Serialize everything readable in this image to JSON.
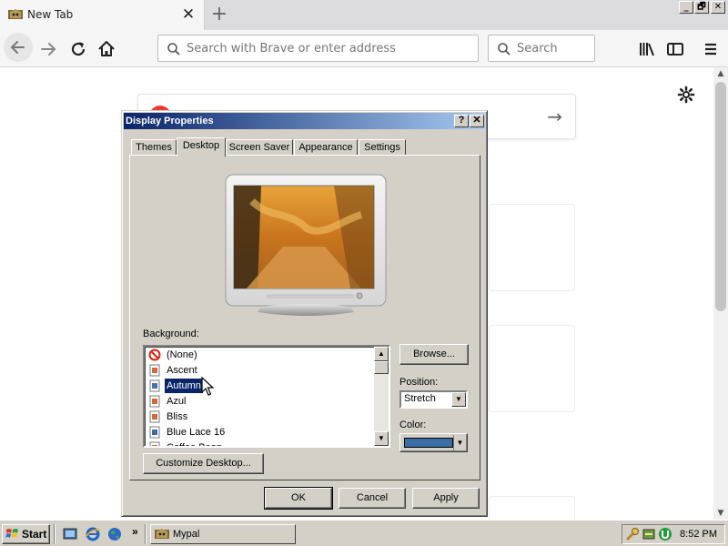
{
  "browser": {
    "tab_title": "New Tab",
    "tab_close": "✕",
    "new_tab": "+",
    "window_buttons": [
      "_",
      "🗗",
      "✕"
    ],
    "url_placeholder": "Search with Brave or enter address",
    "search_placeholder": "Search"
  },
  "dialog": {
    "title": "Display Properties",
    "help": "?",
    "close": "✕",
    "tabs": [
      {
        "label": "Themes",
        "active": false
      },
      {
        "label": "Desktop",
        "active": true
      },
      {
        "label": "Screen Saver",
        "active": false
      },
      {
        "label": "Appearance",
        "active": false
      },
      {
        "label": "Settings",
        "active": false
      }
    ],
    "background_label": "Background:",
    "backgrounds": [
      {
        "name": "(None)",
        "icon": "none-icon",
        "selected": false
      },
      {
        "name": "Ascent",
        "icon": "image-file-icon",
        "selected": false
      },
      {
        "name": "Autumn",
        "icon": "image-file-icon",
        "selected": true
      },
      {
        "name": "Azul",
        "icon": "image-file-icon",
        "selected": false
      },
      {
        "name": "Bliss",
        "icon": "image-file-icon",
        "selected": false
      },
      {
        "name": "Blue Lace 16",
        "icon": "image-file-icon",
        "selected": false
      },
      {
        "name": "Coffee Bean",
        "icon": "image-file-icon",
        "selected": false
      }
    ],
    "browse_label": "Browse...",
    "position_label": "Position:",
    "position_value": "Stretch",
    "color_label": "Color:",
    "color_value": "#3a6ea5",
    "customize_label": "Customize Desktop...",
    "ok_label": "OK",
    "cancel_label": "Cancel",
    "apply_label": "Apply"
  },
  "taskbar": {
    "start_label": "Start",
    "task_label": "Mypal",
    "clock": "8:52 PM",
    "chevron": "»"
  }
}
